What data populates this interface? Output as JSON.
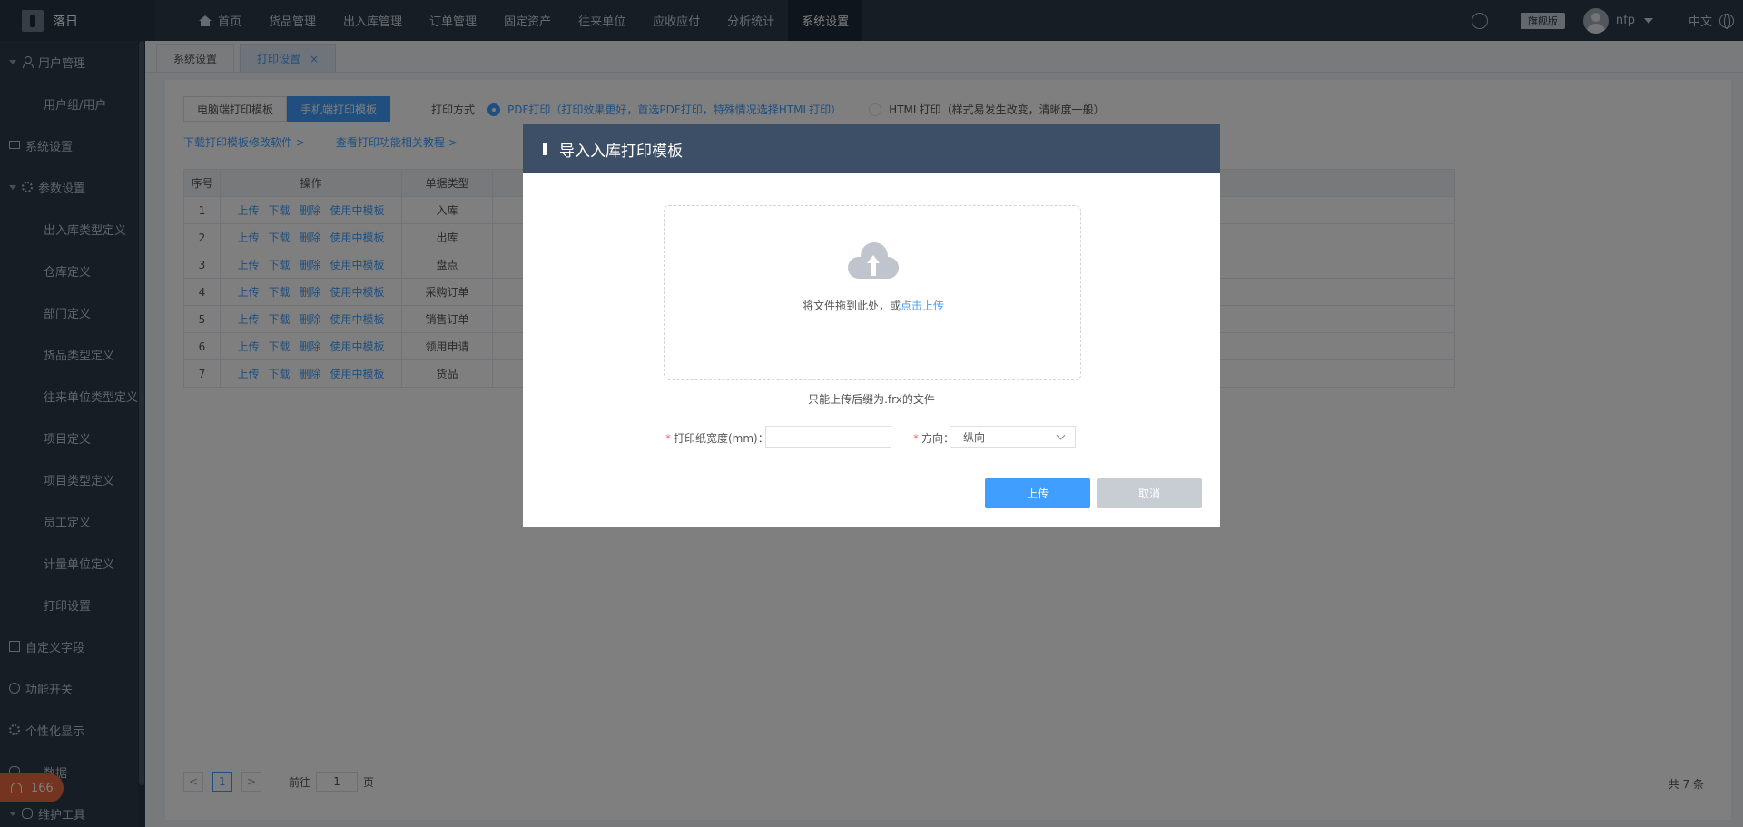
{
  "brand": {
    "name": "落日"
  },
  "nav": {
    "items": [
      "首页",
      "货品管理",
      "出入库管理",
      "订单管理",
      "固定资产",
      "往来单位",
      "应收应付",
      "分析统计",
      "系统设置"
    ]
  },
  "top_right": {
    "edition": "旗舰版",
    "username": "nfp",
    "language": "中文"
  },
  "sidebar": {
    "items": [
      {
        "label": "用户管理",
        "type": "group",
        "icon": "user-icon"
      },
      {
        "label": "用户组/用户",
        "type": "sub"
      },
      {
        "label": "系统设置",
        "type": "plain",
        "icon": "monitor-icon"
      },
      {
        "label": "参数设置",
        "type": "group",
        "icon": "gear-icon"
      },
      {
        "label": "出入库类型定义",
        "type": "sub"
      },
      {
        "label": "仓库定义",
        "type": "sub"
      },
      {
        "label": "部门定义",
        "type": "sub"
      },
      {
        "label": "货品类型定义",
        "type": "sub"
      },
      {
        "label": "往来单位类型定义",
        "type": "sub"
      },
      {
        "label": "项目定义",
        "type": "sub"
      },
      {
        "label": "项目类型定义",
        "type": "sub"
      },
      {
        "label": "员工定义",
        "type": "sub"
      },
      {
        "label": "计量单位定义",
        "type": "sub"
      },
      {
        "label": "打印设置",
        "type": "sub"
      },
      {
        "label": "自定义字段",
        "type": "plain",
        "icon": "doc-icon"
      },
      {
        "label": "功能开关",
        "type": "plain",
        "icon": "power-icon"
      },
      {
        "label": "个性化显示",
        "type": "plain",
        "icon": "gear-icon"
      },
      {
        "label": "数据",
        "type": "plain",
        "icon": "db-icon"
      },
      {
        "label": "维护工具",
        "type": "group",
        "icon": "db-icon"
      }
    ]
  },
  "notification": {
    "count": "166"
  },
  "tabs": [
    {
      "label": "系统设置"
    },
    {
      "label": "打印设置",
      "close": "×"
    }
  ],
  "page": {
    "template_buttons": [
      "电脑端打印模板",
      "手机端打印模板"
    ],
    "print_mode_label": "打印方式",
    "option_pdf": "PDF打印（打印效果更好，首选PDF打印，特殊情况选择HTML打印）",
    "option_html": "HTML打印（样式易发生改变，清晰度一般）",
    "link_download": "下载打印模板修改软件 >",
    "link_tutorial": "查看打印功能相关教程 >"
  },
  "table": {
    "headers": [
      "序号",
      "操作",
      "单据类型"
    ],
    "op_labels": [
      "上传",
      "下载",
      "删除",
      "使用中模板"
    ],
    "rows": [
      {
        "no": "1",
        "type": "入库"
      },
      {
        "no": "2",
        "type": "出库"
      },
      {
        "no": "3",
        "type": "盘点"
      },
      {
        "no": "4",
        "type": "采购订单"
      },
      {
        "no": "5",
        "type": "销售订单"
      },
      {
        "no": "6",
        "type": "领用申请"
      },
      {
        "no": "7",
        "type": "货品"
      }
    ]
  },
  "pager": {
    "prev": "<",
    "current": "1",
    "next": ">",
    "goto_label": "前往",
    "goto_value": "1",
    "page_suffix": "页",
    "total": "共 7 条"
  },
  "dialog": {
    "title": "导入入库打印模板",
    "drop_text": "将文件拖到此处，或",
    "drop_link": "点击上传",
    "tip": "只能上传后缀为.frx的文件",
    "field_width_label": "打印纸宽度(mm)：",
    "field_width_value": "",
    "field_direction_label": "方向：",
    "field_direction_value": "纵向",
    "required_mark": "*",
    "upload_label": "上传",
    "cancel_label": "取消"
  },
  "colors": {
    "primary": "#409eff",
    "nav_bg": "#2d3a4b",
    "dialog_header": "#3d4f66",
    "notification": "#e8683e"
  }
}
